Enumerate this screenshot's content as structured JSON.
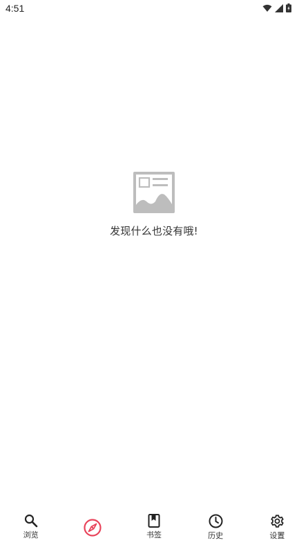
{
  "status_bar": {
    "time": "4:51",
    "icons": [
      "wifi-icon",
      "signal-icon",
      "battery-icon"
    ]
  },
  "empty_state": {
    "icon": "image-placeholder-icon",
    "message": "发现什么也没有哦!"
  },
  "bottom_nav": {
    "active_color": "#e8435a",
    "items": [
      {
        "icon": "search-icon",
        "label": "浏览"
      },
      {
        "icon": "compass-icon",
        "label": "",
        "active": true
      },
      {
        "icon": "bookmark-icon",
        "label": "书签"
      },
      {
        "icon": "clock-icon",
        "label": "历史"
      },
      {
        "icon": "gear-icon",
        "label": "设置"
      }
    ]
  }
}
